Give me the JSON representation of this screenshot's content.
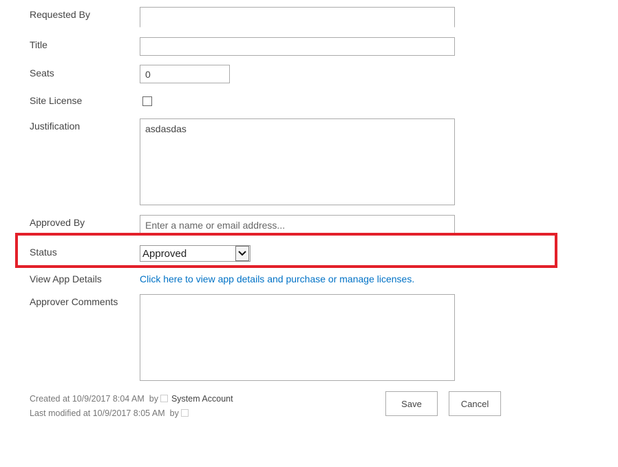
{
  "form": {
    "requested_by": {
      "label": "Requested By",
      "value": ""
    },
    "title": {
      "label": "Title",
      "value": ""
    },
    "seats": {
      "label": "Seats",
      "value": "0"
    },
    "site_license": {
      "label": "Site License",
      "checked": false
    },
    "justification": {
      "label": "Justification",
      "value": "asdasdas"
    },
    "approved_by": {
      "label": "Approved By",
      "placeholder": "Enter a name or email address..."
    },
    "status": {
      "label": "Status",
      "value": "Approved"
    },
    "view_app_details": {
      "label": "View App Details",
      "link": "Click here to view app details and purchase or manage licenses."
    },
    "approver_comments": {
      "label": "Approver Comments",
      "value": ""
    }
  },
  "footer": {
    "created": "Created at 10/9/2017 8:04 AM",
    "by": "by",
    "created_by": "System Account",
    "modified": "Last modified at 10/9/2017 8:05 AM"
  },
  "buttons": {
    "save": "Save",
    "cancel": "Cancel"
  },
  "colors": {
    "highlight": "#e3202a",
    "link": "#0072c6"
  }
}
